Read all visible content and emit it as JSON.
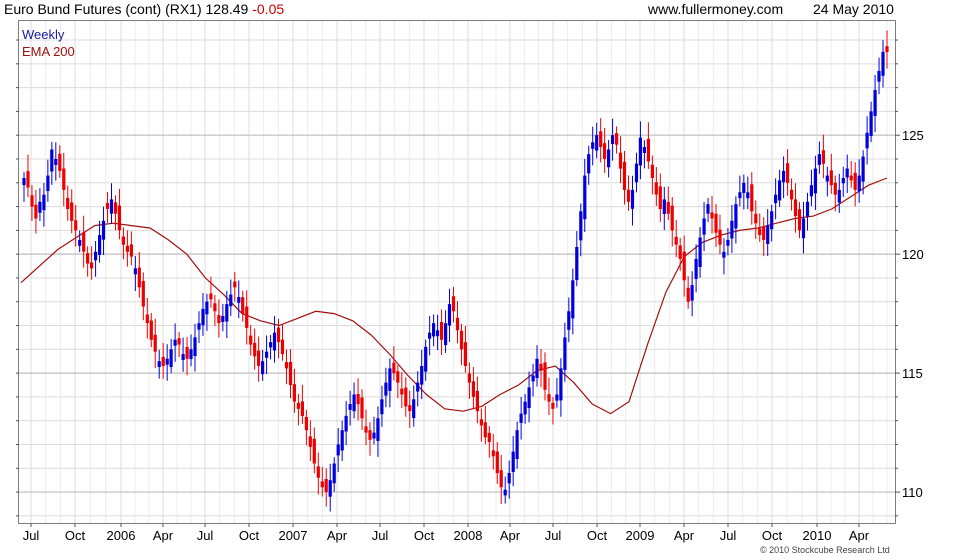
{
  "header": {
    "title": "Euro Bund Futures (cont) (RX1) 128.49",
    "change": "-0.05",
    "site": "www.fullermoney.com",
    "date": "24 May 2010"
  },
  "footer": {
    "copyright": "© 2010 Stockcube Research Ltd"
  },
  "colors": {
    "up": "#0000dd",
    "down": "#ee0000",
    "ema": "#a01010",
    "grid": "#dcdcdc",
    "frame": "#7f7f7f"
  },
  "chart_data": {
    "type": "candlestick",
    "legend": [
      "Weekly",
      "EMA 200"
    ],
    "x_ticks": [
      "Jul",
      "Oct",
      "2006",
      "Apr",
      "Jul",
      "Oct",
      "2007",
      "Apr",
      "Jul",
      "Oct",
      "2008",
      "Apr",
      "Jul",
      "Oct",
      "2009",
      "Apr",
      "Jul",
      "Oct",
      "2010",
      "Apr"
    ],
    "y_ticks": [
      110,
      115,
      120,
      125
    ],
    "ylim": [
      108.7,
      129.8
    ],
    "grid": true,
    "weekly_closes": [
      123.2,
      122.8,
      122.0,
      121.5,
      122.2,
      122.5,
      123.3,
      124.4,
      124.0,
      123.5,
      122.7,
      121.9,
      121.4,
      121.0,
      120.6,
      120.1,
      119.6,
      119.4,
      120.1,
      120.8,
      121.4,
      121.9,
      122.3,
      121.7,
      121.0,
      120.4,
      120.1,
      119.9,
      119.4,
      118.6,
      117.8,
      117.1,
      116.4,
      115.9,
      115.5,
      115.3,
      115.6,
      116.0,
      116.4,
      116.2,
      115.8,
      115.6,
      116.0,
      116.5,
      117.1,
      117.7,
      118.0,
      118.1,
      117.6,
      117.1,
      117.4,
      117.9,
      118.3,
      118.6,
      118.2,
      117.5,
      116.9,
      116.2,
      115.7,
      115.3,
      115.5,
      115.9,
      116.3,
      116.7,
      116.3,
      115.8,
      115.2,
      114.5,
      113.8,
      113.5,
      113.2,
      112.6,
      111.9,
      111.2,
      110.6,
      110.2,
      110.0,
      110.5,
      111.2,
      112.0,
      112.6,
      113.2,
      113.7,
      114.1,
      113.7,
      113.1,
      112.5,
      112.2,
      112.5,
      113.1,
      113.9,
      114.6,
      115.2,
      115.0,
      114.6,
      114.1,
      113.6,
      113.4,
      113.9,
      114.6,
      115.3,
      116.1,
      116.7,
      117.1,
      116.8,
      116.4,
      117.1,
      117.9,
      117.6,
      116.8,
      116.0,
      115.3,
      114.6,
      114.0,
      113.4,
      112.8,
      112.3,
      112.1,
      111.5,
      110.8,
      110.2,
      110.1,
      110.8,
      111.7,
      112.6,
      113.3,
      113.8,
      114.4,
      114.9,
      115.6,
      115.1,
      114.3,
      113.8,
      113.5,
      114.1,
      115.2,
      116.5,
      117.6,
      118.9,
      120.3,
      121.8,
      123.3,
      124.2,
      124.7,
      125.0,
      124.5,
      124.0,
      124.4,
      125.0,
      124.6,
      123.6,
      122.7,
      122.2,
      122.7,
      123.8,
      124.9,
      124.5,
      123.9,
      123.2,
      122.5,
      121.9,
      122.3,
      121.7,
      121.0,
      120.4,
      119.8,
      118.9,
      118.0,
      118.7,
      119.8,
      120.7,
      121.5,
      122.1,
      121.5,
      120.9,
      120.4,
      120.1,
      120.6,
      121.4,
      122.1,
      122.6,
      123.0,
      122.6,
      121.8,
      121.3,
      120.8,
      120.6,
      121.2,
      121.8,
      122.5,
      123.1,
      123.5,
      123.0,
      122.3,
      121.6,
      121.0,
      121.5,
      122.2,
      122.9,
      123.6,
      124.2,
      123.8,
      123.3,
      122.9,
      122.5,
      122.7,
      123.2,
      123.6,
      123.1,
      122.7,
      123.3,
      124.1,
      125.1,
      126.0,
      126.9,
      127.7,
      128.5,
      128.49
    ],
    "ema_200": [
      118.8,
      119.5,
      120.2,
      120.7,
      121.2,
      121.3,
      121.2,
      121.1,
      120.6,
      120.0,
      119.0,
      118.3,
      117.5,
      117.2,
      117.0,
      117.3,
      117.6,
      117.5,
      117.2,
      116.6,
      115.8,
      114.9,
      114.1,
      113.5,
      113.4,
      113.6,
      114.1,
      114.5,
      115.1,
      115.3,
      114.6,
      113.7,
      113.3,
      113.8,
      116.2,
      118.4,
      119.9,
      120.5,
      120.8,
      121.0,
      121.1,
      121.3,
      121.5,
      121.6,
      121.9,
      122.4,
      122.9,
      123.2
    ]
  }
}
